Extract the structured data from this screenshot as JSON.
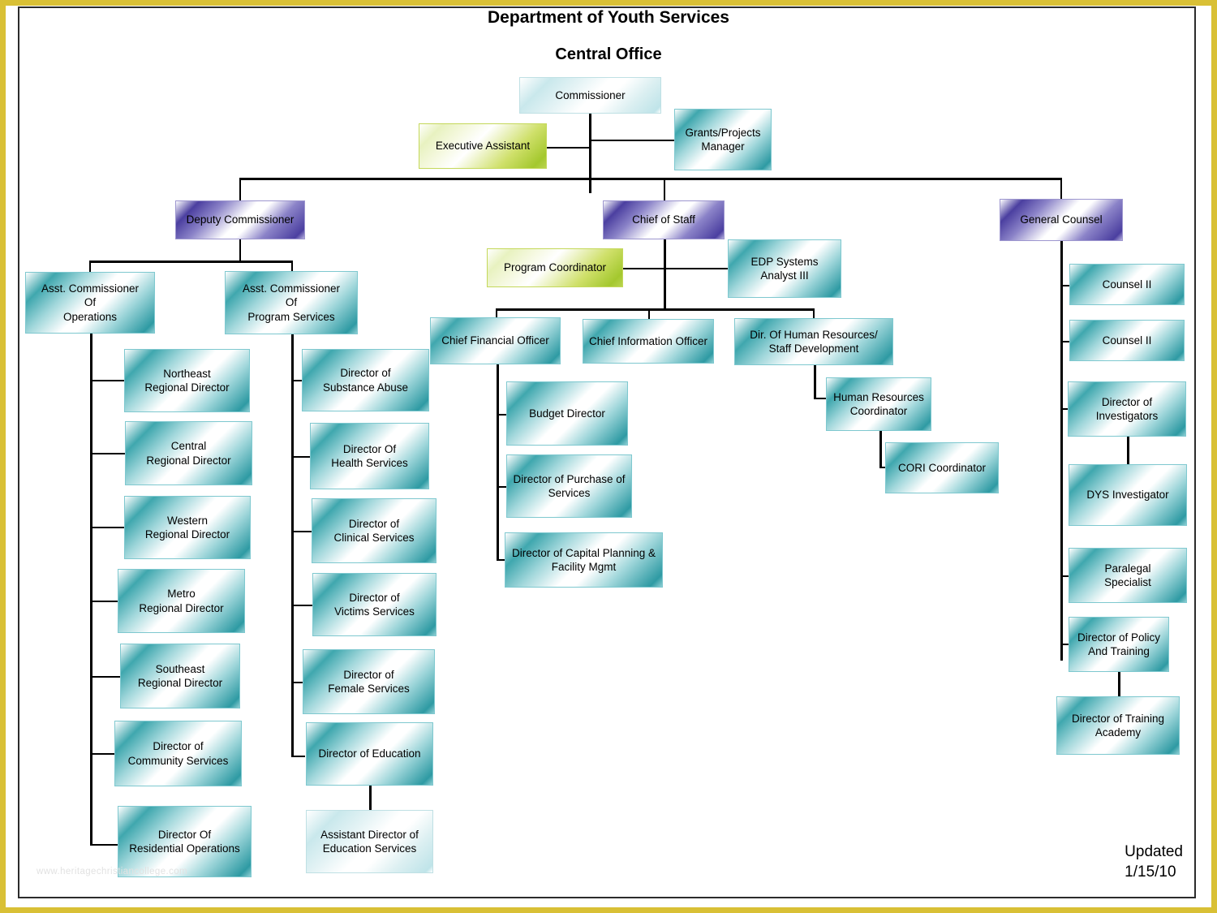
{
  "document": {
    "title_line1": "Department of Youth Services",
    "title_line2": "Central Office",
    "updated_label": "Updated",
    "updated_date": "1/15/10",
    "watermark": "www.heritagechristiancollege.com"
  },
  "theme": {
    "frame_outer": "#d9c035",
    "frame_inner": "#2b2b2b",
    "teal": "#2e9aa3",
    "purple": "#4b3fa0",
    "green": "#a4c82e",
    "line": "#000000",
    "page_background": "#ffffff"
  },
  "chart_data": {
    "type": "diagram",
    "diagram_kind": "organizational-chart",
    "title": "Department of Youth Services Central Office",
    "node_count": 34,
    "nodes": [
      {
        "id": "commissioner",
        "label": "Commissioner",
        "style": "teal-light",
        "parent": null,
        "level": 0
      },
      {
        "id": "executive-assistant",
        "label": "Executive Assistant",
        "style": "green",
        "parent": "commissioner",
        "level": 1,
        "relation": "staff"
      },
      {
        "id": "grants-projects-manager",
        "label": "Grants/Projects Manager",
        "style": "teal",
        "parent": "commissioner",
        "level": 1,
        "relation": "staff"
      },
      {
        "id": "deputy-commissioner",
        "label": "Deputy Commissioner",
        "style": "purple",
        "parent": "commissioner",
        "level": 1
      },
      {
        "id": "chief-of-staff",
        "label": "Chief of Staff",
        "style": "purple",
        "parent": "commissioner",
        "level": 1
      },
      {
        "id": "general-counsel",
        "label": "General Counsel",
        "style": "purple",
        "parent": "commissioner",
        "level": 1
      },
      {
        "id": "asst-commissioner-operations",
        "label": "Asst. Commissioner\nOf\nOperations",
        "style": "teal",
        "parent": "deputy-commissioner",
        "level": 2
      },
      {
        "id": "asst-commissioner-program-services",
        "label": "Asst.  Commissioner\nOf\nProgram Services",
        "style": "teal",
        "parent": "deputy-commissioner",
        "level": 2
      },
      {
        "id": "northeast-regional-director",
        "label": "Northeast\nRegional Director",
        "style": "teal",
        "parent": "asst-commissioner-operations",
        "level": 3
      },
      {
        "id": "central-regional-director",
        "label": "Central\nRegional Director",
        "style": "teal",
        "parent": "asst-commissioner-operations",
        "level": 3
      },
      {
        "id": "western-regional-director",
        "label": "Western\nRegional Director",
        "style": "teal",
        "parent": "asst-commissioner-operations",
        "level": 3
      },
      {
        "id": "metro-regional-director",
        "label": "Metro\nRegional Director",
        "style": "teal",
        "parent": "asst-commissioner-operations",
        "level": 3
      },
      {
        "id": "southeast-regional-director",
        "label": "Southeast\nRegional Director",
        "style": "teal",
        "parent": "asst-commissioner-operations",
        "level": 3
      },
      {
        "id": "director-community-services",
        "label": "Director of\nCommunity Services",
        "style": "teal",
        "parent": "asst-commissioner-operations",
        "level": 3
      },
      {
        "id": "director-residential-operations",
        "label": "Director Of\nResidential Operations",
        "style": "teal",
        "parent": "asst-commissioner-operations",
        "level": 3
      },
      {
        "id": "director-substance-abuse",
        "label": "Director of\nSubstance Abuse",
        "style": "teal",
        "parent": "asst-commissioner-program-services",
        "level": 3
      },
      {
        "id": "director-health-services",
        "label": "Director Of\nHealth Services",
        "style": "teal",
        "parent": "asst-commissioner-program-services",
        "level": 3
      },
      {
        "id": "director-clinical-services",
        "label": "Director of\nClinical Services",
        "style": "teal",
        "parent": "asst-commissioner-program-services",
        "level": 3
      },
      {
        "id": "director-victims-services",
        "label": "Director of\nVictims Services",
        "style": "teal",
        "parent": "asst-commissioner-program-services",
        "level": 3
      },
      {
        "id": "director-female-services",
        "label": "Director of\nFemale Services",
        "style": "teal",
        "parent": "asst-commissioner-program-services",
        "level": 3
      },
      {
        "id": "director-education",
        "label": "Director of Education",
        "style": "teal",
        "parent": "asst-commissioner-program-services",
        "level": 3
      },
      {
        "id": "assistant-director-education-services",
        "label": "Assistant Director of\nEducation Services",
        "style": "teal-light",
        "parent": "director-education",
        "level": 4
      },
      {
        "id": "program-coordinator",
        "label": "Program Coordinator",
        "style": "green",
        "parent": "chief-of-staff",
        "level": 2,
        "relation": "staff"
      },
      {
        "id": "edp-systems-analyst-iii",
        "label": "EDP Systems\nAnalyst III",
        "style": "teal",
        "parent": "chief-of-staff",
        "level": 2,
        "relation": "staff"
      },
      {
        "id": "chief-financial-officer",
        "label": "Chief Financial Officer",
        "style": "teal",
        "parent": "chief-of-staff",
        "level": 3
      },
      {
        "id": "chief-information-officer",
        "label": "Chief Information Officer",
        "style": "teal",
        "parent": "chief-of-staff",
        "level": 3
      },
      {
        "id": "dir-human-resources-staff-development",
        "label": "Dir. Of Human Resources/\nStaff Development",
        "style": "teal",
        "parent": "chief-of-staff",
        "level": 3
      },
      {
        "id": "budget-director",
        "label": "Budget Director",
        "style": "teal",
        "parent": "chief-financial-officer",
        "level": 4
      },
      {
        "id": "director-purchase-of-services",
        "label": "Director of Purchase of\nServices",
        "style": "teal",
        "parent": "chief-financial-officer",
        "level": 4
      },
      {
        "id": "director-capital-planning",
        "label": "Director of Capital Planning &\nFacility Mgmt",
        "style": "teal",
        "parent": "chief-financial-officer",
        "level": 4
      },
      {
        "id": "human-resources-coordinator",
        "label": "Human Resources\nCoordinator",
        "style": "teal",
        "parent": "dir-human-resources-staff-development",
        "level": 4
      },
      {
        "id": "cori-coordinator",
        "label": "CORI Coordinator",
        "style": "teal",
        "parent": "human-resources-coordinator",
        "level": 5
      },
      {
        "id": "counsel-ii-1",
        "label": "Counsel II",
        "style": "teal",
        "parent": "general-counsel",
        "level": 2
      },
      {
        "id": "counsel-ii-2",
        "label": "Counsel II",
        "style": "teal",
        "parent": "general-counsel",
        "level": 2
      },
      {
        "id": "director-investigators",
        "label": "Director of\nInvestigators",
        "style": "teal",
        "parent": "general-counsel",
        "level": 2
      },
      {
        "id": "dys-investigator",
        "label": "DYS Investigator",
        "style": "teal",
        "parent": "director-investigators",
        "level": 3
      },
      {
        "id": "paralegal-specialist",
        "label": "Paralegal\nSpecialist",
        "style": "teal",
        "parent": "general-counsel",
        "level": 2
      },
      {
        "id": "director-policy-and-training",
        "label": "Director of Policy\nAnd Training",
        "style": "teal",
        "parent": "general-counsel",
        "level": 2
      },
      {
        "id": "director-training-academy",
        "label": "Director of Training\nAcademy",
        "style": "teal",
        "parent": "director-policy-and-training",
        "level": 3
      }
    ]
  },
  "nodes": {
    "commissioner": "Commissioner",
    "executive_assistant": "Executive Assistant",
    "grants_projects_manager": "Grants/Projects\nManager",
    "deputy_commissioner": "Deputy Commissioner",
    "chief_of_staff": "Chief of Staff",
    "general_counsel": "General Counsel",
    "asst_commissioner_operations": "Asst. Commissioner\nOf\nOperations",
    "asst_commissioner_program_services": "Asst.  Commissioner\nOf\nProgram Services",
    "northeast_regional_director": "Northeast\nRegional Director",
    "central_regional_director": "Central\nRegional Director",
    "western_regional_director": "Western\nRegional Director",
    "metro_regional_director": "Metro\nRegional Director",
    "southeast_regional_director": "Southeast\nRegional Director",
    "director_community_services": "Director of\nCommunity Services",
    "director_residential_operations": "Director Of\nResidential Operations",
    "director_substance_abuse": "Director of\nSubstance Abuse",
    "director_health_services": "Director Of\nHealth Services",
    "director_clinical_services": "Director of\nClinical Services",
    "director_victims_services": "Director of\nVictims Services",
    "director_female_services": "Director of\nFemale Services",
    "director_education": "Director of Education",
    "assistant_director_education_services": "Assistant Director of\nEducation Services",
    "program_coordinator": "Program Coordinator",
    "edp_systems_analyst": "EDP Systems\nAnalyst III",
    "chief_financial_officer": "Chief Financial Officer",
    "chief_information_officer": "Chief Information Officer",
    "dir_human_resources": "Dir. Of Human Resources/\nStaff Development",
    "budget_director": "Budget Director",
    "director_purchase_of_services": "Director of Purchase of\nServices",
    "director_capital_planning": "Director of Capital Planning &\nFacility Mgmt",
    "human_resources_coordinator": "Human Resources\nCoordinator",
    "cori_coordinator": "CORI Coordinator",
    "counsel_ii_1": "Counsel II",
    "counsel_ii_2": "Counsel II",
    "director_investigators": "Director of\nInvestigators",
    "dys_investigator": "DYS Investigator",
    "paralegal_specialist": "Paralegal\nSpecialist",
    "director_policy_and_training": "Director of Policy\nAnd Training",
    "director_training_academy": "Director of Training\nAcademy"
  }
}
